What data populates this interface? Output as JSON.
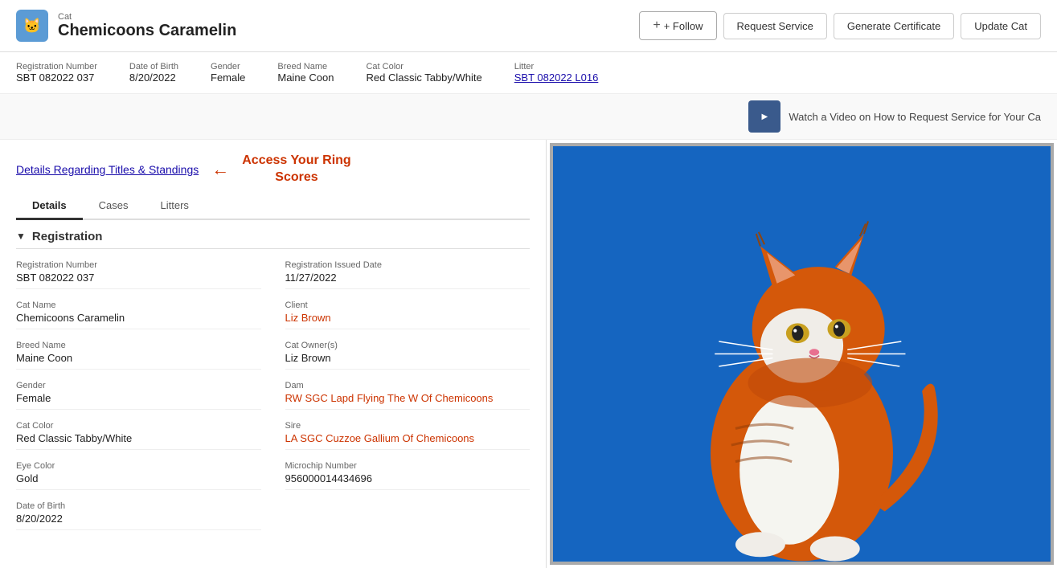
{
  "header": {
    "icon": "🐱",
    "cat_label": "Cat",
    "cat_name": "Chemicoons Caramelin"
  },
  "buttons": {
    "follow": "+ Follow",
    "request_service": "Request Service",
    "generate_certificate": "Generate Certificate",
    "update_cat": "Update Cat"
  },
  "info_bar": {
    "fields": [
      {
        "label": "Registration Number",
        "value": "SBT 082022 037",
        "link": false
      },
      {
        "label": "Date of Birth",
        "value": "8/20/2022",
        "link": false
      },
      {
        "label": "Gender",
        "value": "Female",
        "link": false
      },
      {
        "label": "Breed Name",
        "value": "Maine Coon",
        "link": false
      },
      {
        "label": "Cat Color",
        "value": "Red Classic Tabby/White",
        "link": false
      },
      {
        "label": "Litter",
        "value": "SBT 082022 L016",
        "link": true
      }
    ]
  },
  "video_banner": {
    "text": "Watch a Video on How to Request Service for Your Ca"
  },
  "titles_link": "Details Regarding Titles & Standings",
  "access_scores": "Access Your Ring\nScores",
  "tabs": [
    {
      "label": "Details",
      "active": true
    },
    {
      "label": "Cases",
      "active": false
    },
    {
      "label": "Litters",
      "active": false
    }
  ],
  "registration_section": {
    "title": "Registration",
    "left_fields": [
      {
        "label": "Registration Number",
        "value": "SBT 082022 037",
        "link": false
      },
      {
        "label": "Cat Name",
        "value": "Chemicoons Caramelin",
        "link": false
      },
      {
        "label": "Breed Name",
        "value": "Maine Coon",
        "link": false
      },
      {
        "label": "Gender",
        "value": "Female",
        "link": false
      },
      {
        "label": "Cat Color",
        "value": "Red Classic Tabby/White",
        "link": false
      },
      {
        "label": "Eye Color",
        "value": "Gold",
        "link": false
      },
      {
        "label": "Date of Birth",
        "value": "8/20/2022",
        "link": false
      }
    ],
    "right_fields": [
      {
        "label": "Registration Issued Date",
        "value": "11/27/2022",
        "link": false
      },
      {
        "label": "Client",
        "value": "Liz Brown",
        "link": true
      },
      {
        "label": "Cat Owner(s)",
        "value": "Liz Brown",
        "link": false
      },
      {
        "label": "Dam",
        "value": "RW SGC Lapd Flying The W Of Chemicoons",
        "link": true
      },
      {
        "label": "Sire",
        "value": "LA SGC Cuzzoe Gallium Of Chemicoons",
        "link": true
      },
      {
        "label": "Microchip Number",
        "value": "956000014434696",
        "link": false
      }
    ]
  }
}
